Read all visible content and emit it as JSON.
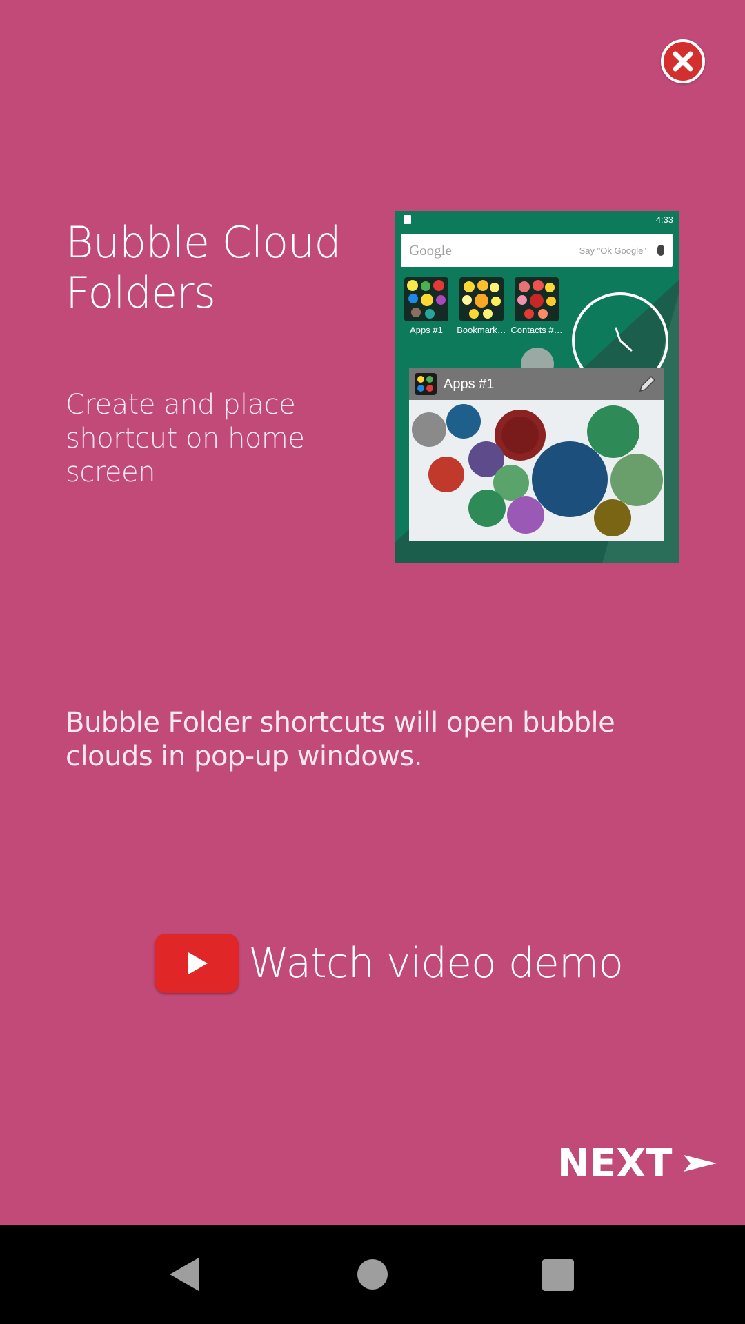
{
  "intro": {
    "title": "Bubble Cloud Folders",
    "subtitle": "Create and place shortcut on home screen",
    "description": "Bubble Folder shortcuts will open bubble clouds in pop-up windows.",
    "demo_label": "Watch video demo",
    "next_label": "NEXT"
  },
  "preview": {
    "status_time": "4:33",
    "search_brand": "Google",
    "search_hint": "Say \"Ok Google\"",
    "folders": [
      {
        "label": "Apps #1"
      },
      {
        "label": "Bookmark…"
      },
      {
        "label": "Contacts #…"
      }
    ],
    "popup_title": "Apps #1"
  },
  "colors": {
    "background": "#C14A78",
    "close": "#D32F2F",
    "youtube": "#E02626",
    "navbar": "#000000"
  },
  "icons": [
    "close-icon",
    "youtube-play-icon",
    "next-arrow-icon",
    "nav-back-icon",
    "nav-home-icon",
    "nav-recents-icon",
    "mic-icon",
    "pencil-icon"
  ]
}
